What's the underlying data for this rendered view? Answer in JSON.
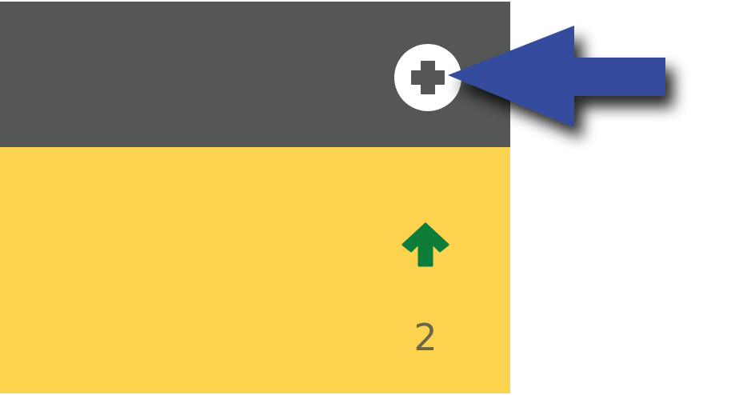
{
  "panel": {
    "header_color": "#555756",
    "content_color": "#fcd34f"
  },
  "add_button": {
    "icon": "plus-circle-icon"
  },
  "trend": {
    "icon": "arrow-up-icon",
    "color": "#0f7d3a",
    "count": "2"
  },
  "callout": {
    "icon": "pointer-arrow-icon",
    "color": "#344b9e"
  }
}
